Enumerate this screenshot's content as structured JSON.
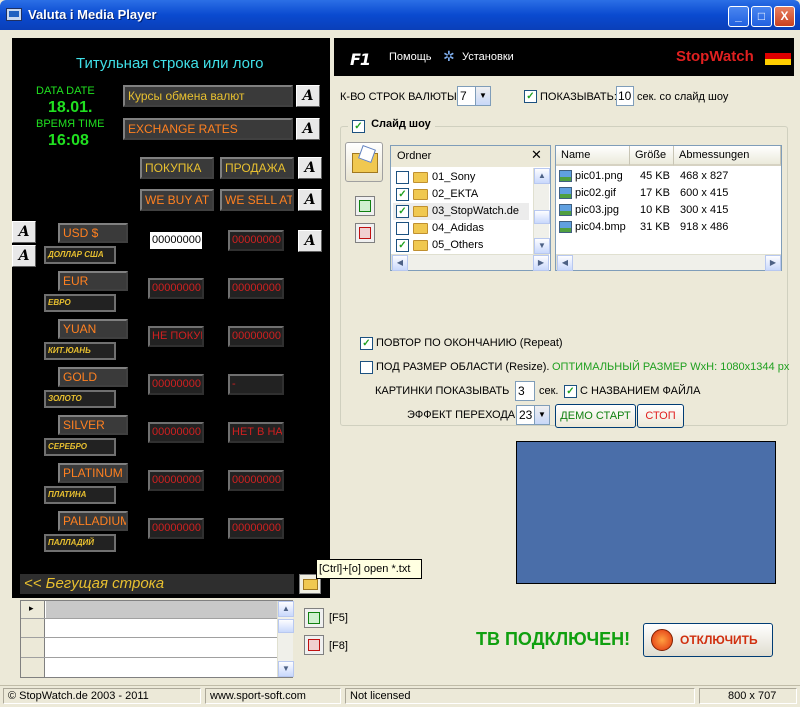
{
  "window": {
    "title": "Valuta i Media Player",
    "min": "_",
    "max": "□",
    "close": "X"
  },
  "left": {
    "title": "Титульная строка или лого",
    "date_label": "DATA DATE",
    "date_value": "18.01.",
    "time_label": "ВРЕМЯ TIME",
    "time_value": "16:08",
    "rates_ru": "Курсы обмена валют",
    "rates_en": "EXCHANGE RATES",
    "buy_ru": "ПОКУПКА",
    "sell_ru": "ПРОДАЖА",
    "buy_en": "WE BUY AT",
    "sell_en": "WE SELL AT",
    "font_button": "A",
    "currencies": [
      {
        "code": "USD $",
        "name": "ДОЛЛАР США",
        "buy": "00000000",
        "sell": "00000000"
      },
      {
        "code": "EUR",
        "name": "ЕВРО",
        "buy": "00000000",
        "sell": "00000000"
      },
      {
        "code": "YUAN",
        "name": "КИТ.ЮАНЬ",
        "buy": "НЕ ПОКУП",
        "sell": "00000000"
      },
      {
        "code": "GOLD",
        "name": "ЗОЛОТО",
        "buy": "00000000",
        "sell": "-"
      },
      {
        "code": "SILVER",
        "name": "СЕРЕБРО",
        "buy": "00000000",
        "sell": "НЕТ В НАЛ"
      },
      {
        "code": "PLATINUM",
        "name": "ПЛАТИНА",
        "buy": "00000000",
        "sell": "00000000"
      },
      {
        "code": "PALLADIUM",
        "name": "ПАЛЛАДИЙ",
        "buy": "00000000",
        "sell": "00000000"
      }
    ],
    "ticker": "<< Бегущая строка"
  },
  "header": {
    "logo": "F1",
    "help": "Помощь",
    "settings": "Установки",
    "brand_stop": "Stop",
    "brand_watch": "Watch"
  },
  "settings": {
    "rows_label": "К-ВО СТРОК ВАЛЮТЫ:",
    "rows_value": "7",
    "show_label": "ПОКАЗЫВАТЬ:",
    "show_value": "10",
    "show_suffix": "сек. со слайд шоу",
    "show_checked": "✓"
  },
  "slideshow": {
    "title": "Слайд шоу",
    "checked": "✓",
    "folders_header": "Ordner",
    "folders_close": "✕",
    "folders": [
      {
        "name": "01_Sony",
        "checked": ""
      },
      {
        "name": "02_EKTA",
        "checked": "✓"
      },
      {
        "name": "03_StopWatch.de",
        "checked": "✓"
      },
      {
        "name": "04_Adidas",
        "checked": ""
      },
      {
        "name": "05_Others",
        "checked": "✓"
      }
    ],
    "files_columns": [
      "Name",
      "Größe",
      "Abmessungen"
    ],
    "files": [
      {
        "name": "pic01.png",
        "size": "45 KB",
        "dims": "468 x 827"
      },
      {
        "name": "pic02.gif",
        "size": "17 KB",
        "dims": "600 x 415"
      },
      {
        "name": "pic03.jpg",
        "size": "10 KB",
        "dims": "300 x 415"
      },
      {
        "name": "pic04.bmp",
        "size": "31 KB",
        "dims": "918 x 486"
      }
    ],
    "repeat_label": "ПОВТОР ПО ОКОНЧАНИЮ (Repeat)",
    "repeat_checked": "✓",
    "resize_label": "ПОД РАЗМЕР ОБЛАСТИ (Resize).",
    "resize_checked": "",
    "optimal": "ОПТИМАЛЬНЫЙ РАЗМЕР WxH: 1080x1344 px",
    "pics_label": "КАРТИНКИ ПОКАЗЫВАТЬ",
    "pics_value": "3",
    "pics_suffix": "сек.",
    "filename_label": "С НАЗВАНИЕМ ФАЙЛА",
    "filename_checked": "✓",
    "effect_label": "ЭФФЕКТ ПЕРЕХОДА",
    "effect_value": "23",
    "demo_start": "ДЕМО СТАРТ",
    "stop": "СТОП"
  },
  "bottom": {
    "tooltip": "[Ctrl]+[o] open *.txt",
    "f5": "[F5]",
    "f8": "[F8]",
    "tv_status": "ТВ ПОДКЛЮЧЕН!",
    "disconnect": "ОТКЛЮЧИТЬ",
    "grid_marker": "▸"
  },
  "statusbar": {
    "copyright": "© StopWatch.de 2003 - 2011",
    "url": "www.sport-soft.com",
    "license": "Not licensed",
    "size": "800 x 707"
  },
  "colors": {
    "brand_red": "#e02020",
    "tv_green": "#10a010",
    "panel_black": "#000000",
    "preview_blue": "#4a6ea9"
  }
}
